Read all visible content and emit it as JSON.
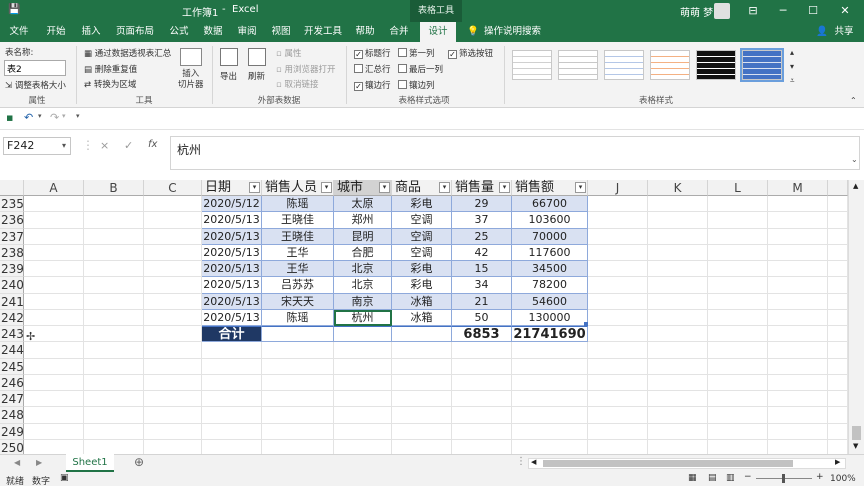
{
  "title": {
    "doc": "工作簿1",
    "sep": "-",
    "app": "Excel",
    "context_tools": "表格工具",
    "user": "萌萌 梦"
  },
  "tabs": [
    "文件",
    "开始",
    "插入",
    "页面布局",
    "公式",
    "数据",
    "审阅",
    "视图",
    "开发工具",
    "帮助",
    "合并",
    "设计"
  ],
  "tell_me": "操作说明搜索",
  "share": "共享",
  "ribbon": {
    "props": {
      "table_name_label": "表名称:",
      "table_name_value": "表2",
      "resize": "调整表格大小",
      "group": "属性"
    },
    "tools": {
      "pivot": "通过数据透视表汇总",
      "dedupe": "删除重复值",
      "to_range": "转换为区域",
      "slicer": "插入\n切片器",
      "group": "工具"
    },
    "external": {
      "export": "导出",
      "refresh": "刷新",
      "properties": "属性",
      "open_browser": "用浏览器打开",
      "unlink": "取消链接",
      "group": "外部表数据"
    },
    "style_options": {
      "header_row": "标题行",
      "total_row": "汇总行",
      "banded_rows": "镶边行",
      "first_col": "第一列",
      "last_col": "最后一列",
      "banded_cols": "镶边列",
      "filter_btn": "筛选按钮",
      "group": "表格样式选项"
    },
    "styles_group": "表格样式"
  },
  "formula": {
    "name_box": "F242",
    "cancel": "×",
    "enter": "✓",
    "fx": "fx",
    "content": "杭州"
  },
  "columns": [
    "A",
    "B",
    "C",
    "",
    "",
    "",
    "",
    "",
    "J",
    "K",
    "L",
    "M"
  ],
  "table_headers": [
    "日期",
    "销售人员",
    "城市",
    "商品",
    "销售量",
    "销售额"
  ],
  "rows": [
    {
      "n": "235",
      "d": "2020/5/12",
      "p": "陈瑶",
      "c": "太原",
      "g": "彩电",
      "q": "29",
      "a": "66700"
    },
    {
      "n": "236",
      "d": "2020/5/13",
      "p": "王晓佳",
      "c": "郑州",
      "g": "空调",
      "q": "37",
      "a": "103600"
    },
    {
      "n": "237",
      "d": "2020/5/13",
      "p": "王晓佳",
      "c": "昆明",
      "g": "空调",
      "q": "25",
      "a": "70000"
    },
    {
      "n": "238",
      "d": "2020/5/13",
      "p": "王华",
      "c": "合肥",
      "g": "空调",
      "q": "42",
      "a": "117600"
    },
    {
      "n": "239",
      "d": "2020/5/13",
      "p": "王华",
      "c": "北京",
      "g": "彩电",
      "q": "15",
      "a": "34500"
    },
    {
      "n": "240",
      "d": "2020/5/13",
      "p": "吕苏苏",
      "c": "北京",
      "g": "彩电",
      "q": "34",
      "a": "78200"
    },
    {
      "n": "241",
      "d": "2020/5/13",
      "p": "宋天天",
      "c": "南京",
      "g": "冰箱",
      "q": "21",
      "a": "54600"
    },
    {
      "n": "242",
      "d": "2020/5/13",
      "p": "陈瑶",
      "c": "杭州",
      "g": "冰箱",
      "q": "50",
      "a": "130000"
    }
  ],
  "total": {
    "n": "243",
    "label": "合计",
    "qty": "6853",
    "amount": "21741690"
  },
  "empty_rows": [
    "244",
    "245",
    "246",
    "247",
    "248",
    "249",
    "250"
  ],
  "sheet_tab": "Sheet1",
  "status": {
    "ready": "就绪",
    "mode": "数字",
    "zoom": "100%"
  },
  "colors": {
    "excel_green": "#217346",
    "band": "#d9e1f2",
    "total_fill": "#1f3864"
  }
}
